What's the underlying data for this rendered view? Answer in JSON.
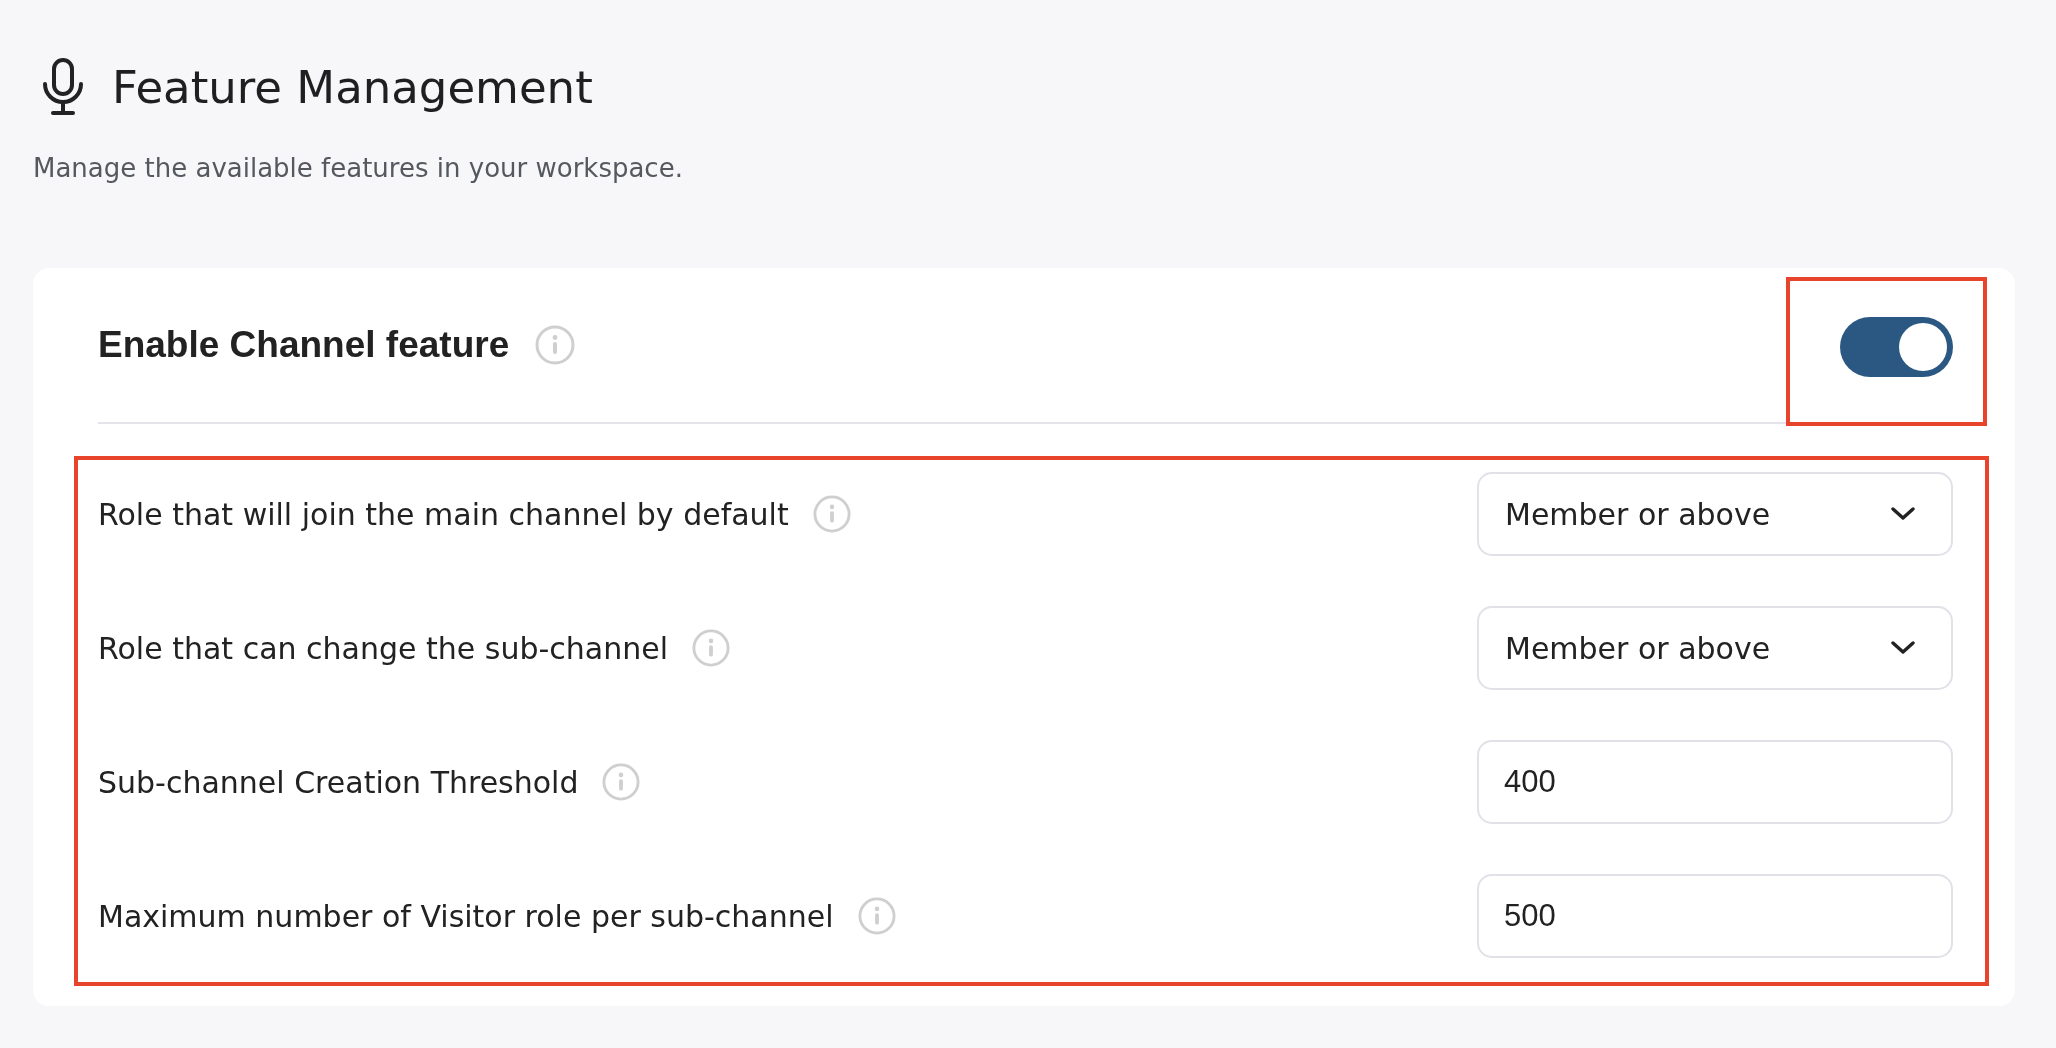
{
  "page": {
    "title": "Feature Management",
    "subtitle": "Manage the available features in your workspace."
  },
  "feature": {
    "label": "Enable Channel feature",
    "on": true,
    "highlighted": true
  },
  "settings": {
    "highlighted": true,
    "items": [
      {
        "kind": "select",
        "label": "Role that will join the main channel by default",
        "value": "Member or above"
      },
      {
        "kind": "select",
        "label": "Role that can change the sub-channel",
        "value": "Member or above"
      },
      {
        "kind": "number",
        "label": "Sub-channel Creation Threshold",
        "value": "400"
      },
      {
        "kind": "number",
        "label": "Maximum number of Visitor role per sub-channel",
        "value": "500"
      }
    ]
  }
}
